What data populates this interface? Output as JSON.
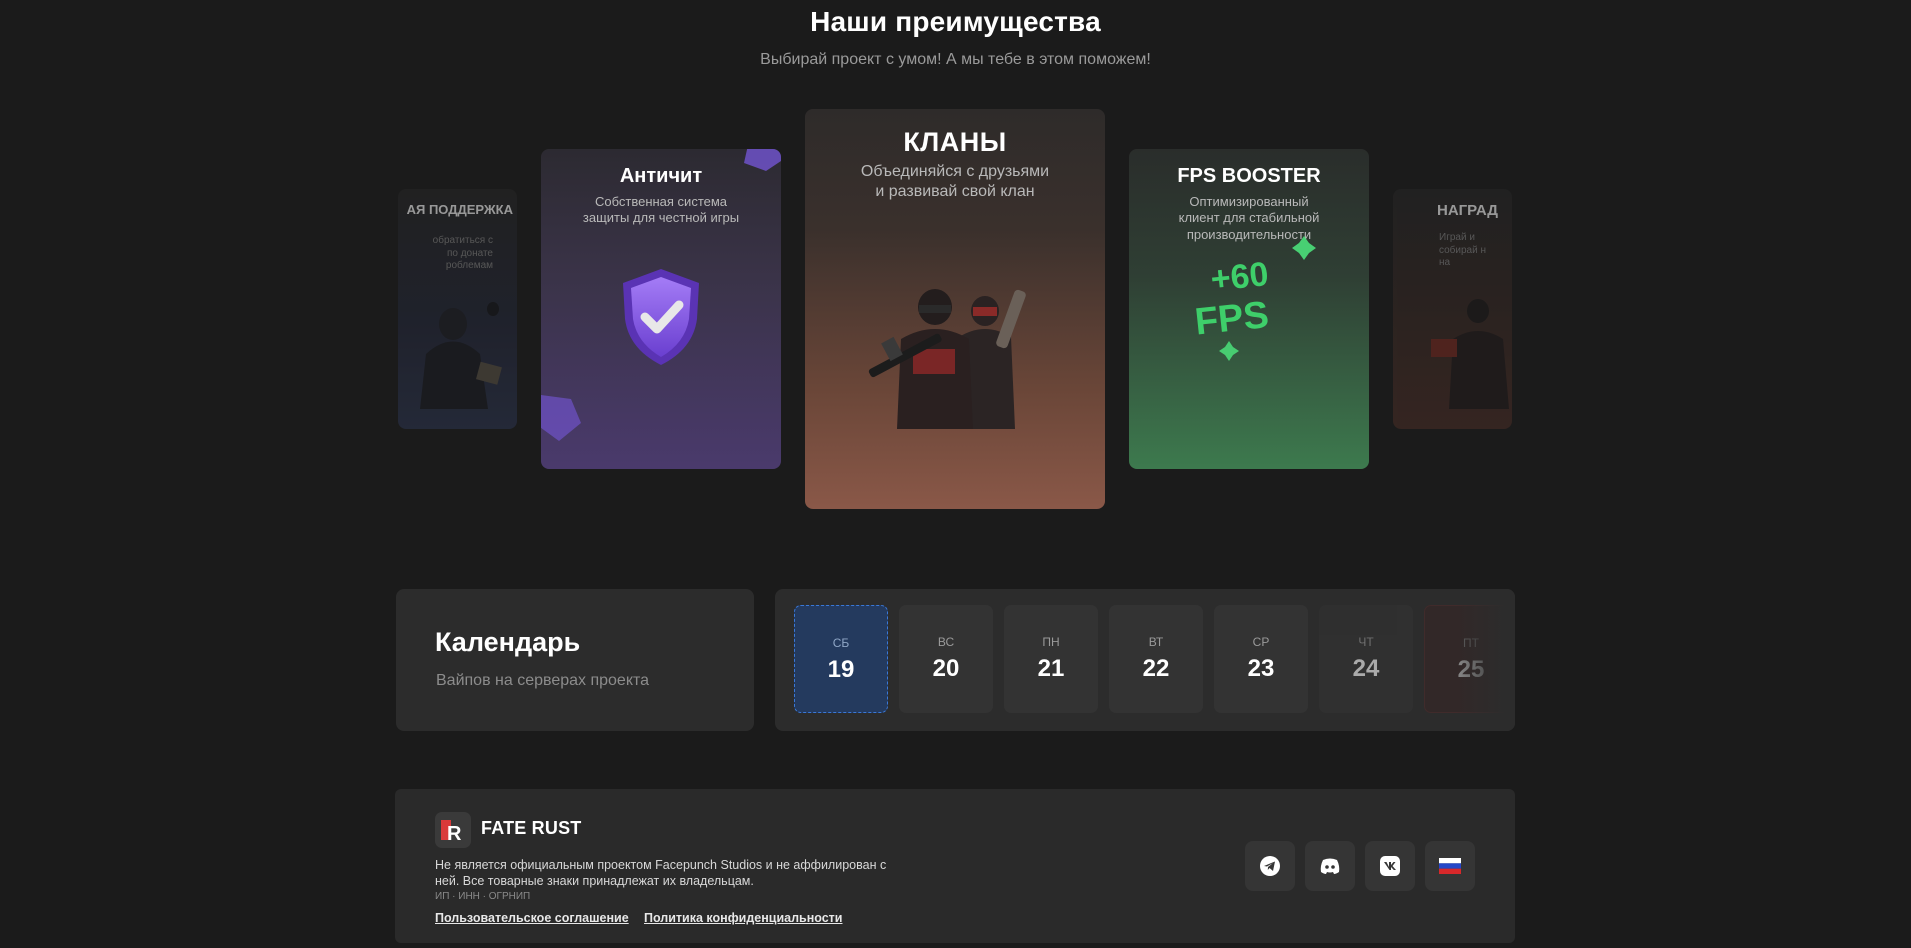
{
  "advantages": {
    "title": "Наши преимущества",
    "subtitle": "Выбирай проект с умом! А мы тебе в этом поможем!",
    "cards": {
      "support": {
        "title": "АЯ ПОДДЕРЖКА",
        "desc_line1": "обратиться с",
        "desc_line2": "по донате",
        "desc_line3": "роблемам"
      },
      "anticheat": {
        "title": "Античит",
        "desc": "Собственная система защиты для честной игры",
        "icon": "shield-check-icon"
      },
      "clans": {
        "title": "КЛАНЫ",
        "desc_line1": "Объединяйся с друзьями",
        "desc_line2": "и развивай свой клан"
      },
      "fps": {
        "title": "FPS BOOSTER",
        "desc_line1": "Оптимизированный",
        "desc_line2": "клиент для стабильной",
        "desc_line3": "производительности",
        "art_line1": "+60",
        "art_line2": "FPS"
      },
      "rewards": {
        "title": "НАГРАД",
        "desc_line1": "Играй и",
        "desc_line2": "собирай н",
        "desc_line3": "на"
      }
    }
  },
  "calendar": {
    "title": "Календарь",
    "subtitle": "Вайпов на серверах проекта",
    "days": [
      {
        "name": "СБ",
        "num": "19"
      },
      {
        "name": "ВС",
        "num": "20"
      },
      {
        "name": "ПН",
        "num": "21"
      },
      {
        "name": "ВТ",
        "num": "22"
      },
      {
        "name": "СР",
        "num": "23"
      },
      {
        "name": "ЧТ",
        "num": "24"
      },
      {
        "name": "ПТ",
        "num": "25"
      }
    ]
  },
  "footer": {
    "logo_letter": "R",
    "brand": "FATE RUST",
    "disclaimer": "Не является официальным проектом Facepunch Studios и не аффилирован с ней. Все товарные знаки принадлежат их владельцам.",
    "legal": "ИП · ИНН · ОГРНИП",
    "link_terms": "Пользовательское соглашение",
    "link_privacy": "Политика конфиденциальности",
    "socials": [
      "telegram-icon",
      "discord-icon",
      "vk-icon",
      "russian-flag-icon"
    ]
  },
  "colors": {
    "background": "#1b1b1b",
    "panel": "#2c2c2c",
    "active_day": "#243a5e",
    "accent_blue": "#3a78d8",
    "accent_green": "#3ecf6a",
    "accent_purple": "#8a5cf0",
    "brand_red": "#d93a3a"
  }
}
